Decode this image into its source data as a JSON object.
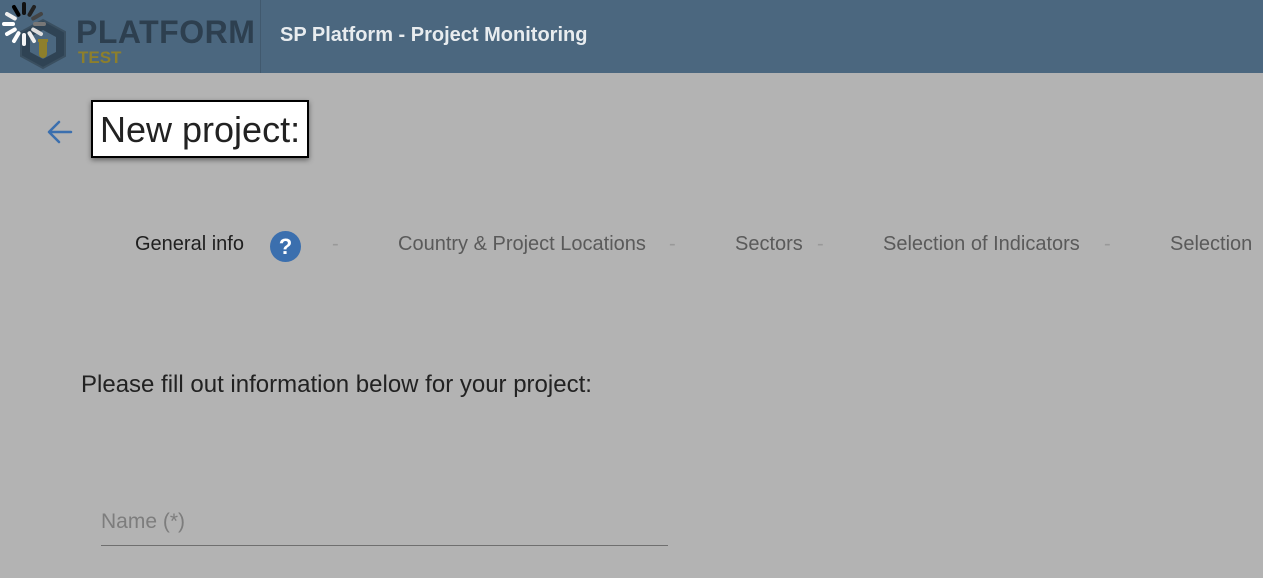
{
  "header": {
    "logo_text": "PLATFORM",
    "logo_sub": "TEST",
    "app_title": "SP Platform - Project Monitoring"
  },
  "page": {
    "title": "New project:"
  },
  "stepper": {
    "steps": [
      {
        "label": "General info",
        "active": true
      },
      {
        "label": "Country & Project Locations",
        "active": false
      },
      {
        "label": "Sectors",
        "active": false
      },
      {
        "label": "Selection of Indicators",
        "active": false
      },
      {
        "label": "Selection",
        "active": false
      }
    ],
    "separator": "-",
    "help_symbol": "?"
  },
  "form": {
    "intro": "Please fill out information below for your project:",
    "name_placeholder": "Name (*)",
    "name_value": ""
  },
  "colors": {
    "topbar": "#4b677f",
    "overlay_bg": "#b3b3b3",
    "accent_blue": "#3b6fae",
    "logo_yellow": "#8d7f2c"
  },
  "icons": [
    "loading-spinner-icon",
    "logo-mark-icon",
    "back-arrow-icon",
    "help-icon"
  ]
}
